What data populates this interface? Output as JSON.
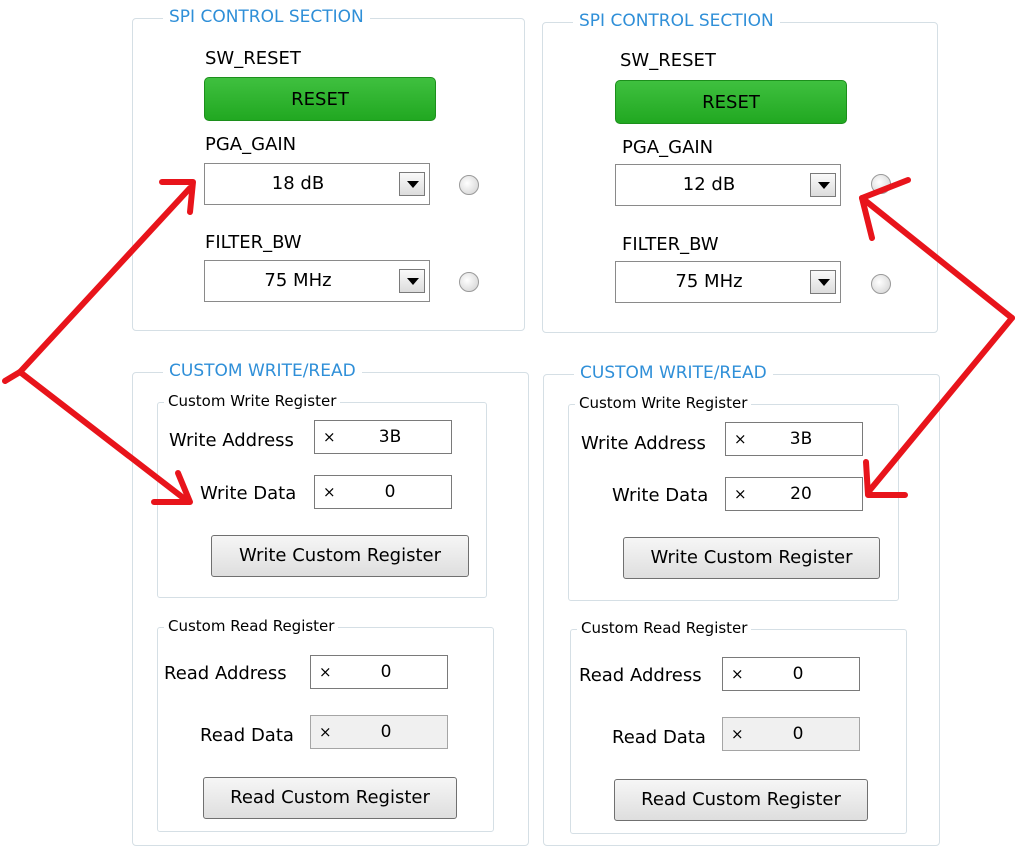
{
  "panels": [
    {
      "spi": {
        "title": "SPI CONTROL SECTION",
        "sw_reset_label": "SW_RESET",
        "reset_button": "RESET",
        "pga_gain_label": "PGA_GAIN",
        "pga_gain_value": "18 dB",
        "filter_bw_label": "FILTER_BW",
        "filter_bw_value": "75 MHz"
      },
      "custom": {
        "title": "CUSTOM WRITE/READ",
        "write": {
          "title": "Custom Write Register",
          "address_label": "Write Address",
          "address_prefix": "×",
          "address_value": "3B",
          "data_label": "Write Data",
          "data_prefix": "×",
          "data_value": "0",
          "button": "Write Custom Register"
        },
        "read": {
          "title": "Custom Read Register",
          "address_label": "Read Address",
          "address_prefix": "×",
          "address_value": "0",
          "data_label": "Read Data",
          "data_prefix": "×",
          "data_value": "0",
          "button": "Read Custom Register"
        }
      }
    },
    {
      "spi": {
        "title": "SPI CONTROL SECTION",
        "sw_reset_label": "SW_RESET",
        "reset_button": "RESET",
        "pga_gain_label": "PGA_GAIN",
        "pga_gain_value": "12 dB",
        "filter_bw_label": "FILTER_BW",
        "filter_bw_value": "75 MHz"
      },
      "custom": {
        "title": "CUSTOM WRITE/READ",
        "write": {
          "title": "Custom Write Register",
          "address_label": "Write Address",
          "address_prefix": "×",
          "address_value": "3B",
          "data_label": "Write Data",
          "data_prefix": "×",
          "data_value": "20",
          "button": "Write Custom Register"
        },
        "read": {
          "title": "Custom Read Register",
          "address_label": "Read Address",
          "address_prefix": "×",
          "address_value": "0",
          "data_label": "Read Data",
          "data_prefix": "×",
          "data_value": "0",
          "button": "Read Custom Register"
        }
      }
    }
  ],
  "colors": {
    "group_title": "#2f8fd8",
    "reset_green": "#21a821",
    "annotation_red": "#e8141b"
  }
}
